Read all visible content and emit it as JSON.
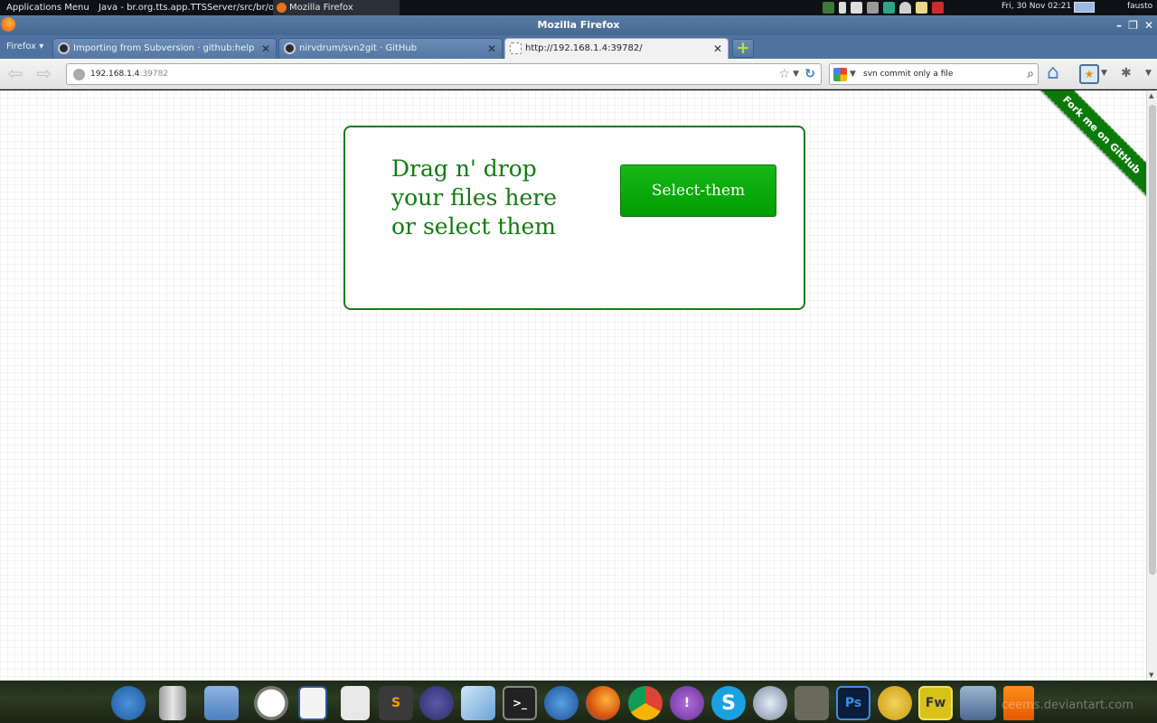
{
  "top_panel": {
    "apps_menu": "Applications Menu",
    "java_window": "Java - br.org.tts.app.TTSServer/src/br/or...",
    "firefox_window": "Mozilla Firefox",
    "clock": "Fri, 30 Nov 02:21",
    "user": "fausto"
  },
  "window": {
    "title": "Mozilla Firefox"
  },
  "tabs": {
    "firefox_menu": "Firefox",
    "items": [
      {
        "label": "Importing from Subversion · github:help"
      },
      {
        "label": "nirvdrum/svn2git · GitHub"
      },
      {
        "label": "http://192.168.1.4:39782/"
      }
    ]
  },
  "navbar": {
    "url_host": "192.168.1.4",
    "url_port": ":39782",
    "search_value": "svn commit only a file"
  },
  "page": {
    "drop_line1": "Drag n' drop",
    "drop_line2": "your files here",
    "drop_line3": "or select them",
    "select_button": "Select-them",
    "fork_ribbon": "Fork me on GitHub"
  },
  "dock": {
    "watermark": "ceems.deviantart.com",
    "icons": [
      "xfce-mouse-icon",
      "trash-icon",
      "folder-icon",
      "clock-icon",
      "document-icon",
      "text-editor-icon",
      "sublime-text-icon",
      "eclipse-icon",
      "virtualbox-icon",
      "terminal-icon",
      "network-icon",
      "firefox-icon",
      "chrome-icon",
      "pidgin-icon",
      "skype-icon",
      "inkscape-icon",
      "gimp-icon",
      "photoshop-icon",
      "flash-icon",
      "fireworks-icon",
      "screen-icon",
      "vlc-icon"
    ]
  },
  "colors": {
    "accent_green": "#137a13",
    "button_green": "#0aad0a",
    "titlebar_blue": "#4f72a0"
  }
}
